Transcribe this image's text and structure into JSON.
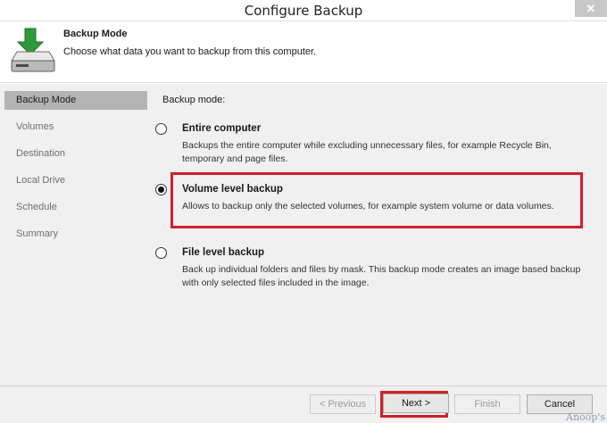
{
  "window": {
    "title": "Configure Backup",
    "close_glyph": "✕"
  },
  "header": {
    "icon": "download-drive-icon",
    "title": "Backup Mode",
    "description": "Choose what data you want to backup from this computer."
  },
  "sidebar": {
    "items": [
      {
        "label": "Backup Mode",
        "active": true
      },
      {
        "label": "Volumes",
        "active": false
      },
      {
        "label": "Destination",
        "active": false
      },
      {
        "label": "Local Drive",
        "active": false
      },
      {
        "label": "Schedule",
        "active": false
      },
      {
        "label": "Summary",
        "active": false
      }
    ]
  },
  "content": {
    "mode_label": "Backup mode:",
    "options": [
      {
        "title": "Entire computer",
        "description": "Backups the entire computer while excluding unnecessary files, for example Recycle Bin, temporary and page files.",
        "selected": false
      },
      {
        "title": "Volume level backup",
        "description": "Allows to backup only the selected volumes, for example system volume or data volumes.",
        "selected": true
      },
      {
        "title": "File level backup",
        "description": "Back up individual folders and files by mask. This backup mode creates an image based backup with only selected files included in the image.",
        "selected": false
      }
    ]
  },
  "footer": {
    "previous_label": "< Previous",
    "next_label": "Next >",
    "finish_label": "Finish",
    "cancel_label": "Cancel",
    "watermark": "Anoop's"
  },
  "colors": {
    "highlight": "#d2202a",
    "icon_green": "#2f9a3c",
    "sidebar_active": "#b4b4b4"
  }
}
